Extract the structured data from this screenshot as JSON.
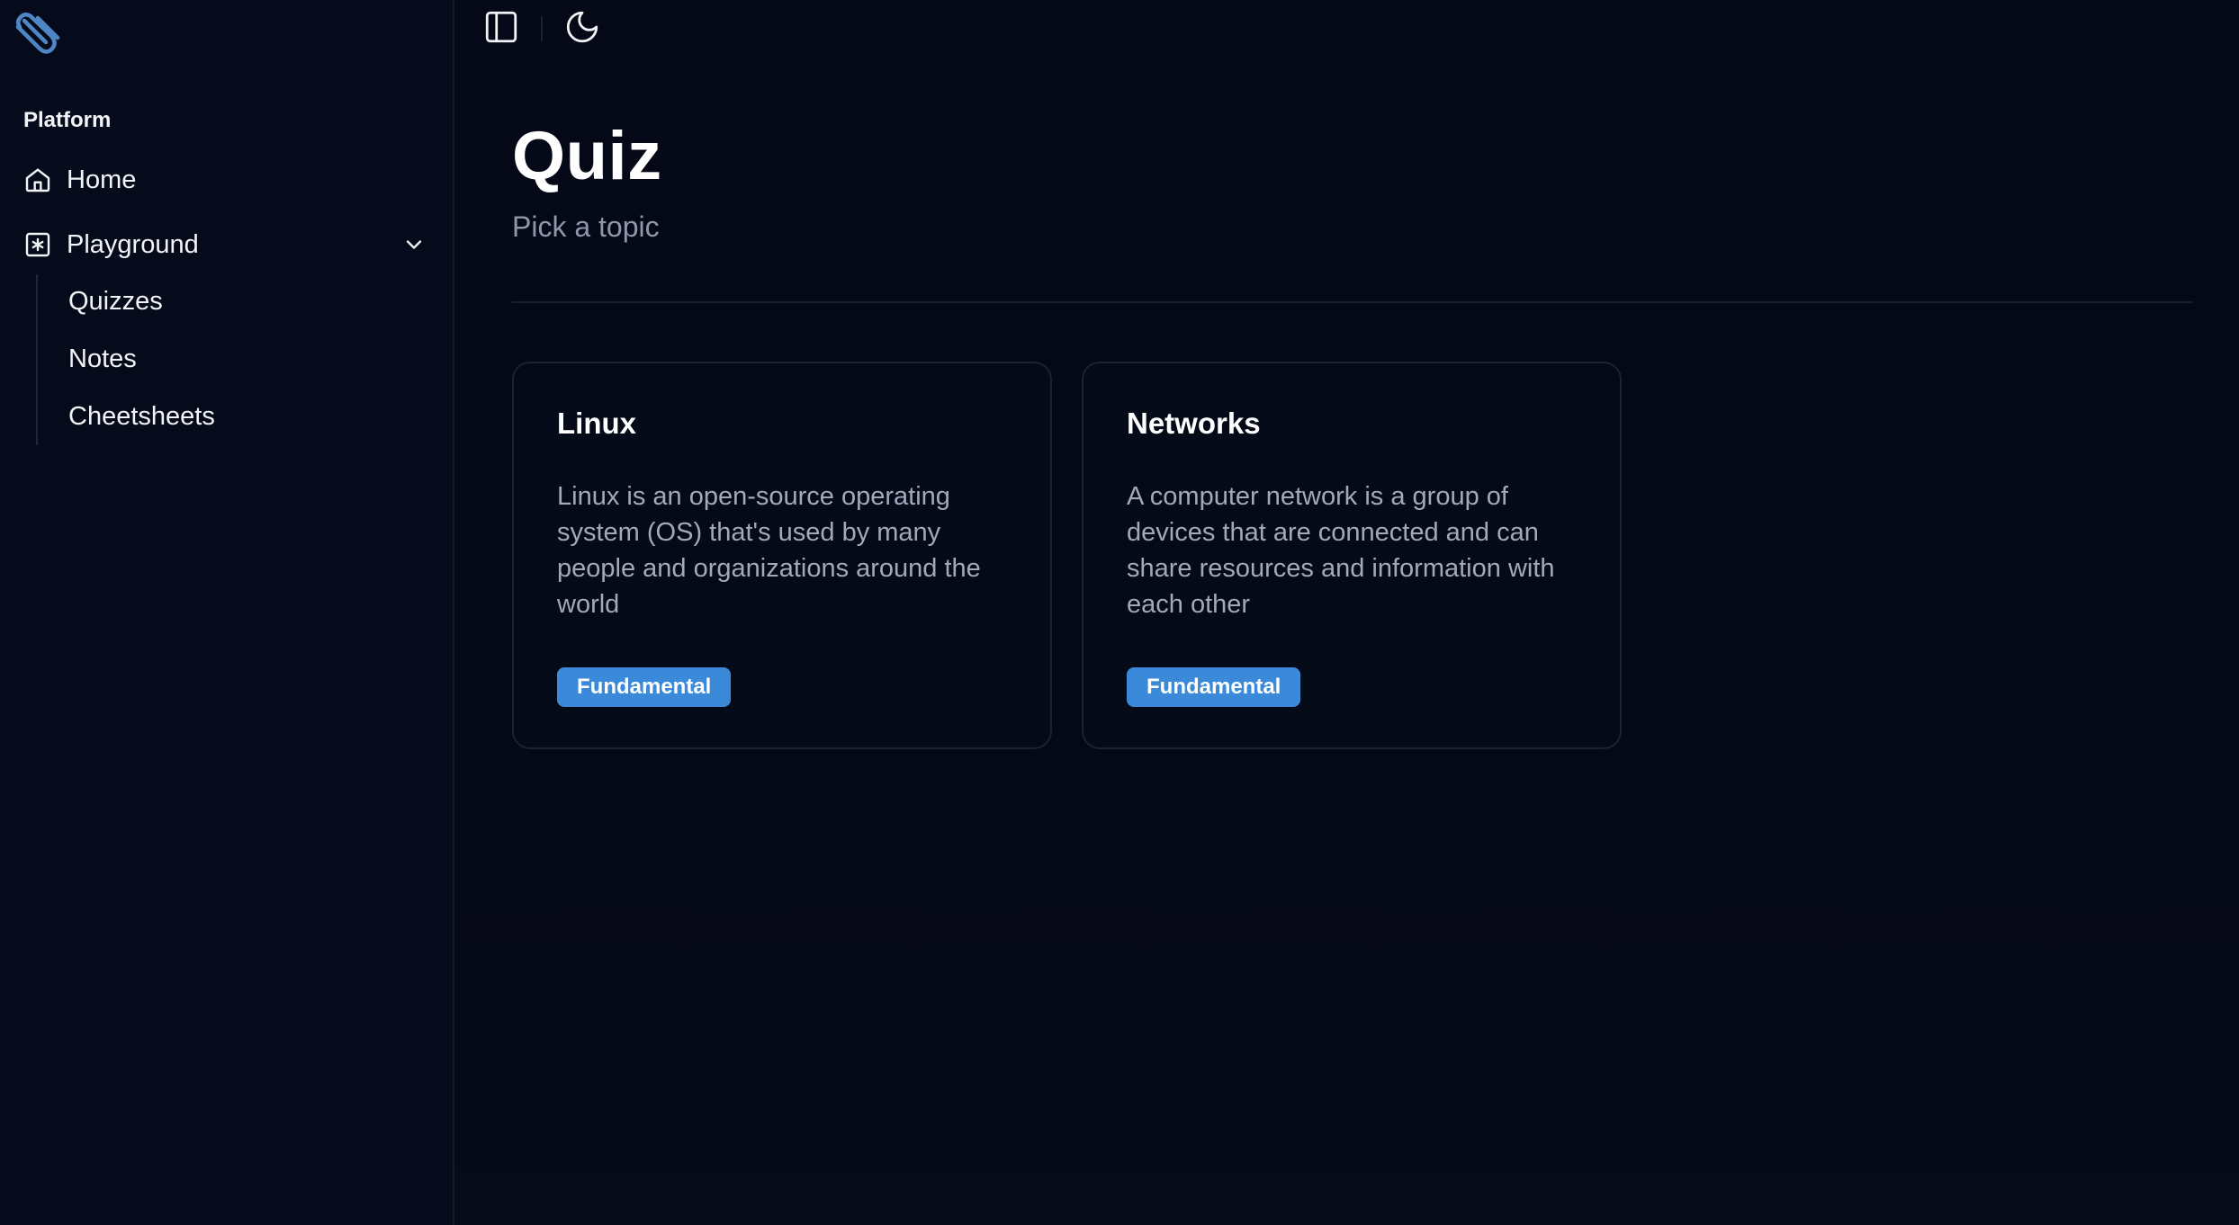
{
  "sidebar": {
    "section_label": "Platform",
    "home_label": "Home",
    "playground_label": "Playground",
    "sub_items": [
      {
        "label": "Quizzes"
      },
      {
        "label": "Notes"
      },
      {
        "label": "Cheetsheets"
      }
    ]
  },
  "topbar": {
    "icons": [
      "sidebar-toggle-icon",
      "moon-icon"
    ]
  },
  "main": {
    "title": "Quiz",
    "subtitle": "Pick a topic",
    "cards": [
      {
        "title": "Linux",
        "description": "Linux is an open-source operating system (OS) that's used by many people and organizations around the world",
        "badge": "Fundamental"
      },
      {
        "title": "Networks",
        "description": "A computer network is a group of devices that are connected and can share resources and information with each other",
        "badge": "Fundamental"
      }
    ]
  },
  "colors": {
    "background": "#050816",
    "sidebar_background": "#060b1b",
    "accent": "#3b8ad9",
    "logo": "#4e86c6",
    "muted_text": "#8f97aa"
  }
}
